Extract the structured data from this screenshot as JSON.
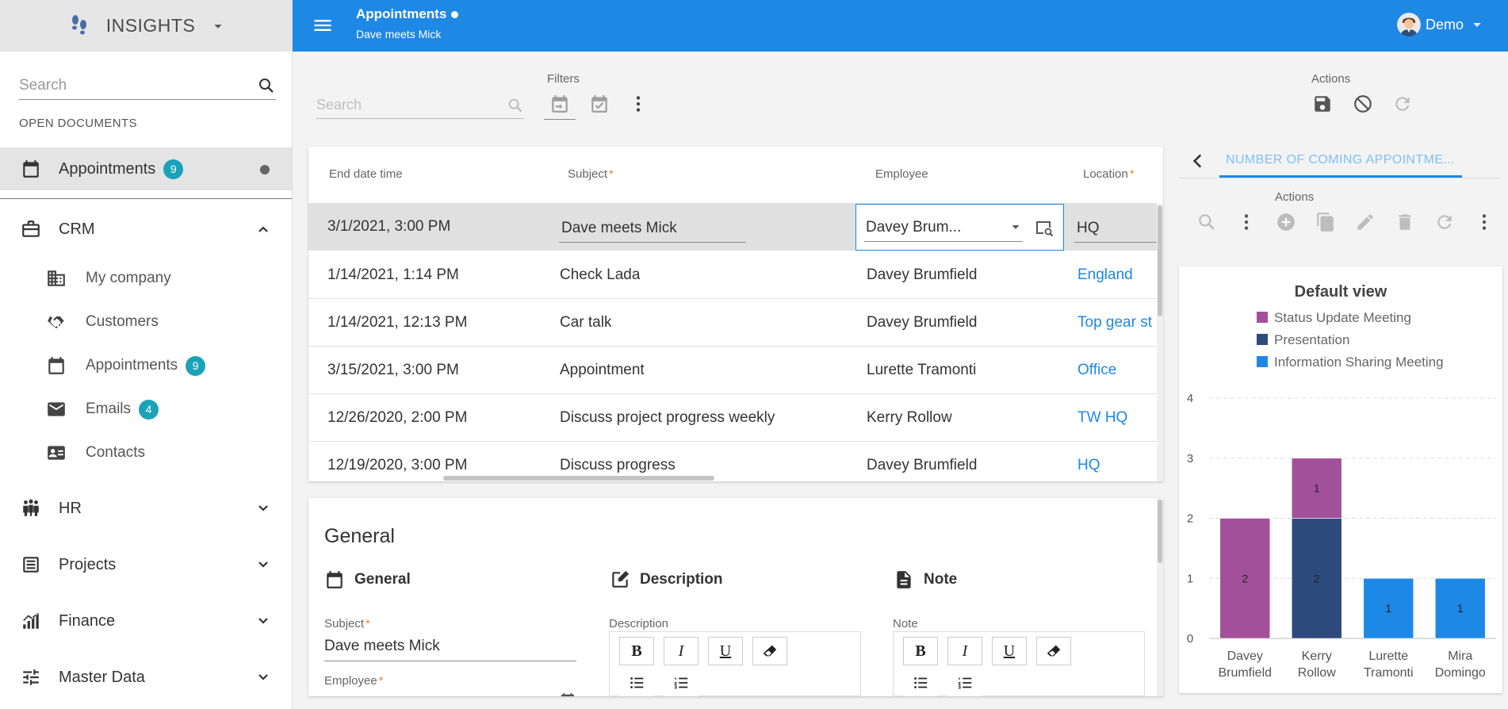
{
  "app": {
    "name": "INSIGHTS"
  },
  "sidebar": {
    "search_placeholder": "Search",
    "open_documents_title": "OPEN DOCUMENTS",
    "open_document": {
      "label": "Appointments",
      "badge": "9"
    },
    "groups": {
      "crm": "CRM",
      "hr": "HR",
      "projects": "Projects",
      "finance": "Finance",
      "master_data": "Master Data"
    },
    "crm_items": [
      {
        "label": "My company",
        "icon": "building-icon"
      },
      {
        "label": "Customers",
        "icon": "handshake-icon"
      },
      {
        "label": "Appointments",
        "icon": "calendar-icon",
        "badge": "9"
      },
      {
        "label": "Emails",
        "icon": "email-icon",
        "badge": "4"
      },
      {
        "label": "Contacts",
        "icon": "contact-card-icon"
      }
    ]
  },
  "topbar": {
    "title": "Appointments",
    "subtitle": "Dave meets Mick",
    "user": "Demo",
    "color": "#1e88e5"
  },
  "toolbar": {
    "search_placeholder": "Search",
    "filters_label": "Filters",
    "actions_label": "Actions"
  },
  "grid": {
    "columns": [
      {
        "label": "End date time",
        "required": ""
      },
      {
        "label": "Subject",
        "required": "*"
      },
      {
        "label": "Employee",
        "required": ""
      },
      {
        "label": "Location",
        "required": "*"
      }
    ],
    "rows": [
      {
        "end": "3/1/2021, 3:00 PM",
        "subject": "Dave meets Mick",
        "employee": "Davey Brum...",
        "location": "HQ"
      },
      {
        "end": "1/14/2021, 1:14 PM",
        "subject": "Check Lada",
        "employee": "Davey Brumfield",
        "location": "England"
      },
      {
        "end": "1/14/2021, 12:13 PM",
        "subject": "Car talk",
        "employee": "Davey Brumfield",
        "location": "Top gear st"
      },
      {
        "end": "3/15/2021, 3:00 PM",
        "subject": "Appointment",
        "employee": "Lurette Tramonti",
        "location": "Office"
      },
      {
        "end": "12/26/2020, 2:00 PM",
        "subject": "Discuss project progress weekly",
        "employee": "Kerry Rollow",
        "location": "TW HQ"
      },
      {
        "end": "12/19/2020, 3:00 PM",
        "subject": "Discuss progress",
        "employee": "Davey Brumfield",
        "location": "HQ"
      }
    ]
  },
  "form": {
    "title": "General",
    "sections": {
      "general": "General",
      "description": "Description",
      "note": "Note"
    },
    "subject_label": "Subject",
    "subject_value": "Dave meets Mick",
    "employee_label": "Employee",
    "description_label": "Description",
    "note_label": "Note",
    "req": "*",
    "rte": {
      "bold": "B",
      "italic": "I",
      "underline": "U"
    }
  },
  "right_panel": {
    "tab_label": "NUMBER OF COMING APPOINTME...",
    "actions_label": "Actions"
  },
  "chart_data": {
    "type": "bar",
    "stacked": true,
    "title": "Default view",
    "categories": [
      "Davey Brumfield",
      "Kerry Rollow",
      "Lurette Tramonti",
      "Mira Domingo"
    ],
    "category_lines": [
      [
        "Davey",
        "Brumfield"
      ],
      [
        "Kerry",
        "Rollow"
      ],
      [
        "Lurette",
        "Tramonti"
      ],
      [
        "Mira",
        "Domingo"
      ]
    ],
    "series": [
      {
        "name": "Information Sharing Meeting",
        "color": "#1e88e5",
        "values": [
          0,
          0,
          1,
          1
        ]
      },
      {
        "name": "Presentation",
        "color": "#2c4a7c",
        "values": [
          0,
          2,
          0,
          0
        ]
      },
      {
        "name": "Status Update Meeting",
        "color": "#a2509a",
        "values": [
          2,
          1,
          0,
          0
        ]
      }
    ],
    "legend_order": [
      "Status Update Meeting",
      "Presentation",
      "Information Sharing Meeting"
    ],
    "ylim": [
      0,
      4
    ],
    "yticks": [
      0,
      1,
      2,
      3,
      4
    ],
    "grid": true,
    "legend_position": "top"
  }
}
